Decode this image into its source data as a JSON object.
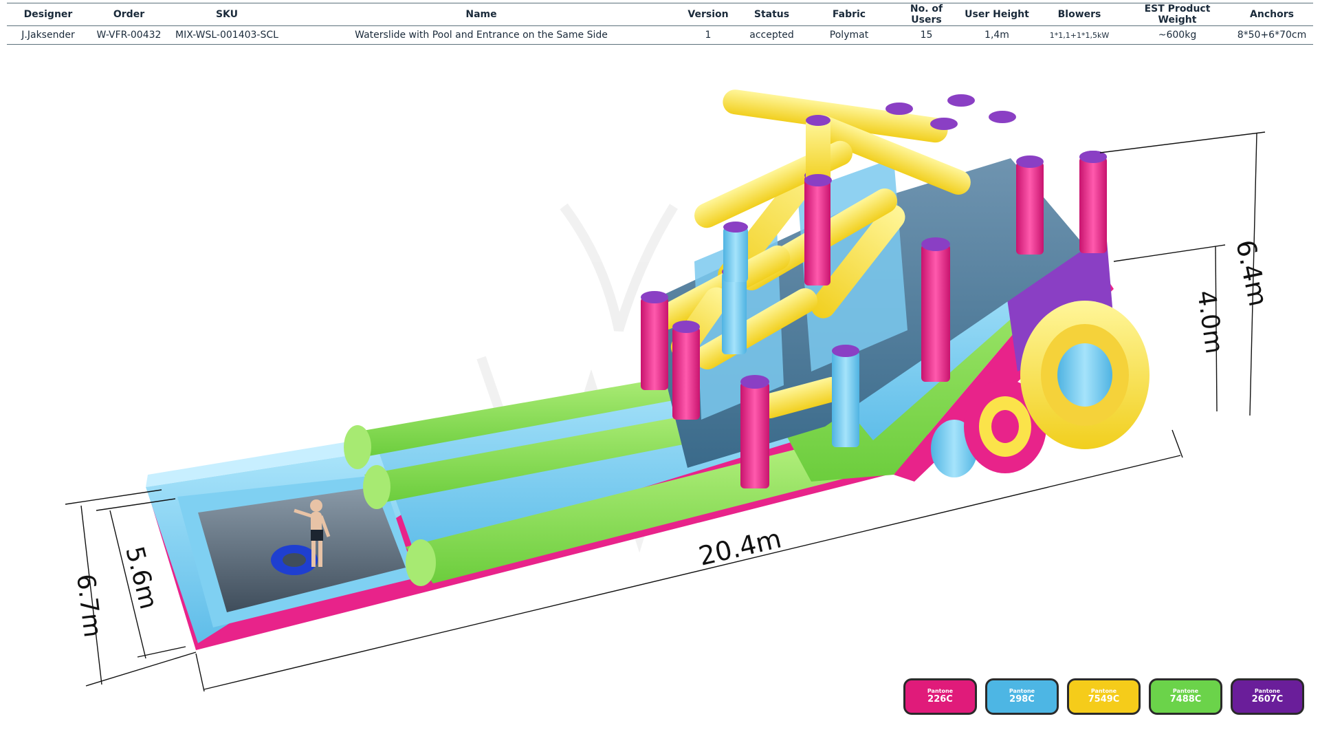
{
  "table": {
    "headers": [
      "Designer",
      "Order",
      "SKU",
      "Name",
      "Version",
      "Status",
      "Fabric",
      "No. of Users",
      "User  Height",
      "Blowers",
      "EST Product Weight",
      "Anchors"
    ],
    "row": [
      "J.Jaksender",
      "W-VFR-00432",
      "MIX-WSL-001403-SCL",
      "Waterslide with Pool and Entrance on the Same Side",
      "1",
      "accepted",
      "Polymat",
      "15",
      "1,4m",
      "1*1,1+1*1,5kW",
      "~600kg",
      "8*50+6*70cm"
    ]
  },
  "dimensions": {
    "length": "20.4m",
    "total_width": "6.7m",
    "pool_width": "5.6m",
    "total_height": "6.4m",
    "platform_height": "4.0m"
  },
  "pantone": {
    "brand": "Pantone",
    "swatches": [
      {
        "code": "226C",
        "color": "#e01b7a"
      },
      {
        "code": "298C",
        "color": "#4db6e4"
      },
      {
        "code": "7549C",
        "color": "#f5cc1a"
      },
      {
        "code": "7488C",
        "color": "#6bd34a"
      },
      {
        "code": "2607C",
        "color": "#6a1e9a"
      }
    ]
  },
  "colors": {
    "pink": "#e8238a",
    "blue": "#6cc8ef",
    "yellow": "#fbe34a",
    "green": "#8fe05a",
    "purple": "#8a3fc4"
  }
}
